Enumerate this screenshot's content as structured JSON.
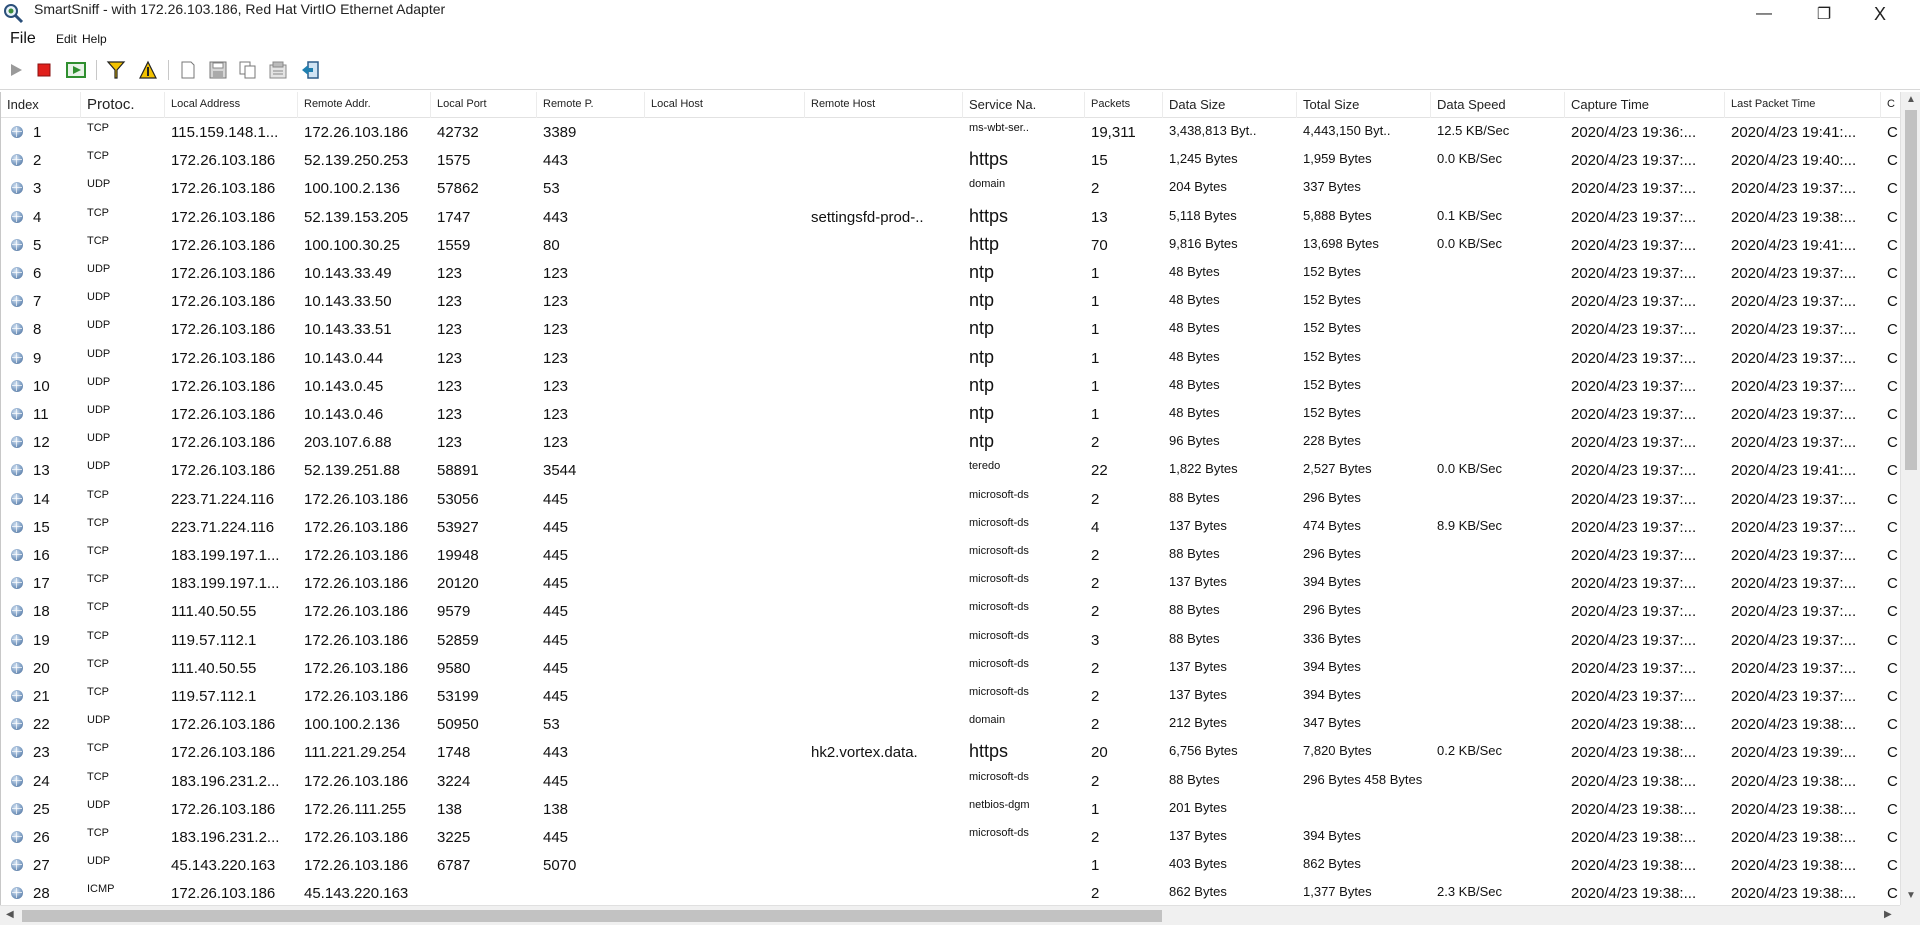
{
  "window": {
    "title": "SmartSniff - with 172.26.103.186, Red Hat VirtIO Ethernet Adapter",
    "min_glyph": "—",
    "max_glyph": "❐",
    "close_glyph": "X"
  },
  "menu": {
    "file": "File",
    "edit": "Edit",
    "help": "Help"
  },
  "toolbar": {
    "icons": [
      "play-icon",
      "stop-icon",
      "capture-icon",
      "filter-icon",
      "warning-filter-icon",
      "new-document-icon",
      "save-icon",
      "copy-icon",
      "properties-icon",
      "exit-icon"
    ],
    "colors": {
      "stop": "#e0201c",
      "play": "#9a9a9a",
      "filter": "#f2c200",
      "capture": "#2f8f2f"
    }
  },
  "columns": [
    {
      "label": "Index",
      "size": "md"
    },
    {
      "label": "Protoc.",
      "size": "xl"
    },
    {
      "label": "Local Address",
      "size": "sm"
    },
    {
      "label": "Remote Addr.",
      "size": "sm"
    },
    {
      "label": "Local Port",
      "size": "sm"
    },
    {
      "label": "Remote P.",
      "size": "sm"
    },
    {
      "label": "Local Host",
      "size": "sm"
    },
    {
      "label": "Remote Host",
      "size": "sm"
    },
    {
      "label": "Service Na.",
      "size": "md"
    },
    {
      "label": "Packets",
      "size": "sm"
    },
    {
      "label": "Data Size",
      "size": "md"
    },
    {
      "label": "Total Size",
      "size": "md"
    },
    {
      "label": "Data Speed",
      "size": "md"
    },
    {
      "label": "Capture Time",
      "size": "md"
    },
    {
      "label": "Last Packet Time",
      "size": "sm"
    },
    {
      "label": "C",
      "size": "sm"
    }
  ],
  "rows": [
    {
      "index": "1",
      "proto": "TCP",
      "laddr": "115.159.148.1...",
      "raddr": "172.26.103.186",
      "lport": "42732",
      "rport": "3389",
      "lhost": "",
      "rhost": "",
      "service": "ms-wbt-ser..",
      "packets": "19,311",
      "data": "3,438,813 Byt..",
      "total": "4,443,150 Byt..",
      "speed": "12.5 KB/Sec",
      "capture": "2020/4/23 19:36:...",
      "last": "2020/4/23 19:41:...",
      "extra": "C"
    },
    {
      "index": "2",
      "proto": "TCP",
      "laddr": "172.26.103.186",
      "raddr": "52.139.250.253",
      "lport": "1575",
      "rport": "443",
      "lhost": "",
      "rhost": "",
      "service": "https",
      "packets": "15",
      "data": "1,245 Bytes",
      "total": "1,959 Bytes",
      "speed": "0.0 KB/Sec",
      "capture": "2020/4/23 19:37:...",
      "last": "2020/4/23 19:40:...",
      "extra": "C"
    },
    {
      "index": "3",
      "proto": "UDP",
      "laddr": "172.26.103.186",
      "raddr": "100.100.2.136",
      "lport": "57862",
      "rport": "53",
      "lhost": "",
      "rhost": "",
      "service": "domain",
      "packets": "2",
      "data": "204 Bytes",
      "total": "337 Bytes",
      "speed": "",
      "capture": "2020/4/23 19:37:...",
      "last": "2020/4/23 19:37:...",
      "extra": "C"
    },
    {
      "index": "4",
      "proto": "TCP",
      "laddr": "172.26.103.186",
      "raddr": "52.139.153.205",
      "lport": "1747",
      "rport": "443",
      "lhost": "",
      "rhost": "settingsfd-prod-..",
      "service": "https",
      "packets": "13",
      "data": "5,118 Bytes",
      "total": "5,888 Bytes",
      "speed": "0.1 KB/Sec",
      "capture": "2020/4/23 19:37:...",
      "last": "2020/4/23 19:38:...",
      "extra": "C"
    },
    {
      "index": "5",
      "proto": "TCP",
      "laddr": "172.26.103.186",
      "raddr": "100.100.30.25",
      "lport": "1559",
      "rport": "80",
      "lhost": "",
      "rhost": "",
      "service": "http",
      "packets": "70",
      "data": "9,816 Bytes",
      "total": "13,698 Bytes",
      "speed": "0.0 KB/Sec",
      "capture": "2020/4/23 19:37:...",
      "last": "2020/4/23 19:41:...",
      "extra": "C"
    },
    {
      "index": "6",
      "proto": "UDP",
      "laddr": "172.26.103.186",
      "raddr": "10.143.33.49",
      "lport": "123",
      "rport": "123",
      "lhost": "",
      "rhost": "",
      "service": "ntp",
      "packets": "1",
      "data": "48 Bytes",
      "total": "152 Bytes",
      "speed": "",
      "capture": "2020/4/23 19:37:...",
      "last": "2020/4/23 19:37:...",
      "extra": "C"
    },
    {
      "index": "7",
      "proto": "UDP",
      "laddr": "172.26.103.186",
      "raddr": "10.143.33.50",
      "lport": "123",
      "rport": "123",
      "lhost": "",
      "rhost": "",
      "service": "ntp",
      "packets": "1",
      "data": "48 Bytes",
      "total": "152 Bytes",
      "speed": "",
      "capture": "2020/4/23 19:37:...",
      "last": "2020/4/23 19:37:...",
      "extra": "C"
    },
    {
      "index": "8",
      "proto": "UDP",
      "laddr": "172.26.103.186",
      "raddr": "10.143.33.51",
      "lport": "123",
      "rport": "123",
      "lhost": "",
      "rhost": "",
      "service": "ntp",
      "packets": "1",
      "data": "48 Bytes",
      "total": "152 Bytes",
      "speed": "",
      "capture": "2020/4/23 19:37:...",
      "last": "2020/4/23 19:37:...",
      "extra": "C"
    },
    {
      "index": "9",
      "proto": "UDP",
      "laddr": "172.26.103.186",
      "raddr": "10.143.0.44",
      "lport": "123",
      "rport": "123",
      "lhost": "",
      "rhost": "",
      "service": "ntp",
      "packets": "1",
      "data": "48 Bytes",
      "total": "152 Bytes",
      "speed": "",
      "capture": "2020/4/23 19:37:...",
      "last": "2020/4/23 19:37:...",
      "extra": "C"
    },
    {
      "index": "10",
      "proto": "UDP",
      "laddr": "172.26.103.186",
      "raddr": "10.143.0.45",
      "lport": "123",
      "rport": "123",
      "lhost": "",
      "rhost": "",
      "service": "ntp",
      "packets": "1",
      "data": "48 Bytes",
      "total": "152 Bytes",
      "speed": "",
      "capture": "2020/4/23 19:37:...",
      "last": "2020/4/23 19:37:...",
      "extra": "C"
    },
    {
      "index": "11",
      "proto": "UDP",
      "laddr": "172.26.103.186",
      "raddr": "10.143.0.46",
      "lport": "123",
      "rport": "123",
      "lhost": "",
      "rhost": "",
      "service": "ntp",
      "packets": "1",
      "data": "48 Bytes",
      "total": "152 Bytes",
      "speed": "",
      "capture": "2020/4/23 19:37:...",
      "last": "2020/4/23 19:37:...",
      "extra": "C"
    },
    {
      "index": "12",
      "proto": "UDP",
      "laddr": "172.26.103.186",
      "raddr": "203.107.6.88",
      "lport": "123",
      "rport": "123",
      "lhost": "",
      "rhost": "",
      "service": "ntp",
      "packets": "2",
      "data": "96 Bytes",
      "total": "228 Bytes",
      "speed": "",
      "capture": "2020/4/23 19:37:...",
      "last": "2020/4/23 19:37:...",
      "extra": "C"
    },
    {
      "index": "13",
      "proto": "UDP",
      "laddr": "172.26.103.186",
      "raddr": "52.139.251.88",
      "lport": "58891",
      "rport": "3544",
      "lhost": "",
      "rhost": "",
      "service": "teredo",
      "packets": "22",
      "data": "1,822 Bytes",
      "total": "2,527 Bytes",
      "speed": "0.0 KB/Sec",
      "capture": "2020/4/23 19:37:...",
      "last": "2020/4/23 19:41:...",
      "extra": "C"
    },
    {
      "index": "14",
      "proto": "TCP",
      "laddr": "223.71.224.116",
      "raddr": "172.26.103.186",
      "lport": "53056",
      "rport": "445",
      "lhost": "",
      "rhost": "",
      "service": "microsoft-ds",
      "packets": "2",
      "data": "88 Bytes",
      "total": "296 Bytes",
      "speed": "",
      "capture": "2020/4/23 19:37:...",
      "last": "2020/4/23 19:37:...",
      "extra": "C"
    },
    {
      "index": "15",
      "proto": "TCP",
      "laddr": "223.71.224.116",
      "raddr": "172.26.103.186",
      "lport": "53927",
      "rport": "445",
      "lhost": "",
      "rhost": "",
      "service": "microsoft-ds",
      "packets": "4",
      "data": "137 Bytes",
      "total": "474 Bytes",
      "speed": "8.9 KB/Sec",
      "capture": "2020/4/23 19:37:...",
      "last": "2020/4/23 19:37:...",
      "extra": "C"
    },
    {
      "index": "16",
      "proto": "TCP",
      "laddr": "183.199.197.1...",
      "raddr": "172.26.103.186",
      "lport": "19948",
      "rport": "445",
      "lhost": "",
      "rhost": "",
      "service": "microsoft-ds",
      "packets": "2",
      "data": "88 Bytes",
      "total": "296 Bytes",
      "speed": "",
      "capture": "2020/4/23 19:37:...",
      "last": "2020/4/23 19:37:...",
      "extra": "C"
    },
    {
      "index": "17",
      "proto": "TCP",
      "laddr": "183.199.197.1...",
      "raddr": "172.26.103.186",
      "lport": "20120",
      "rport": "445",
      "lhost": "",
      "rhost": "",
      "service": "microsoft-ds",
      "packets": "2",
      "data": "137 Bytes",
      "total": "394 Bytes",
      "speed": "",
      "capture": "2020/4/23 19:37:...",
      "last": "2020/4/23 19:37:...",
      "extra": "C"
    },
    {
      "index": "18",
      "proto": "TCP",
      "laddr": "111.40.50.55",
      "raddr": "172.26.103.186",
      "lport": "9579",
      "rport": "445",
      "lhost": "",
      "rhost": "",
      "service": "microsoft-ds",
      "packets": "2",
      "data": "88 Bytes",
      "total": "296 Bytes",
      "speed": "",
      "capture": "2020/4/23 19:37:...",
      "last": "2020/4/23 19:37:...",
      "extra": "C"
    },
    {
      "index": "19",
      "proto": "TCP",
      "laddr": "119.57.112.1",
      "raddr": "172.26.103.186",
      "lport": "52859",
      "rport": "445",
      "lhost": "",
      "rhost": "",
      "service": "microsoft-ds",
      "packets": "3",
      "data": "88 Bytes",
      "total": "336 Bytes",
      "speed": "",
      "capture": "2020/4/23 19:37:...",
      "last": "2020/4/23 19:37:...",
      "extra": "C"
    },
    {
      "index": "20",
      "proto": "TCP",
      "laddr": "111.40.50.55",
      "raddr": "172.26.103.186",
      "lport": "9580",
      "rport": "445",
      "lhost": "",
      "rhost": "",
      "service": "microsoft-ds",
      "packets": "2",
      "data": "137 Bytes",
      "total": "394 Bytes",
      "speed": "",
      "capture": "2020/4/23 19:37:...",
      "last": "2020/4/23 19:37:...",
      "extra": "C"
    },
    {
      "index": "21",
      "proto": "TCP",
      "laddr": "119.57.112.1",
      "raddr": "172.26.103.186",
      "lport": "53199",
      "rport": "445",
      "lhost": "",
      "rhost": "",
      "service": "microsoft-ds",
      "packets": "2",
      "data": "137 Bytes",
      "total": "394 Bytes",
      "speed": "",
      "capture": "2020/4/23 19:37:...",
      "last": "2020/4/23 19:37:...",
      "extra": "C"
    },
    {
      "index": "22",
      "proto": "UDP",
      "laddr": "172.26.103.186",
      "raddr": "100.100.2.136",
      "lport": "50950",
      "rport": "53",
      "lhost": "",
      "rhost": "",
      "service": "domain",
      "packets": "2",
      "data": "212 Bytes",
      "total": "347 Bytes",
      "speed": "",
      "capture": "2020/4/23 19:38:...",
      "last": "2020/4/23 19:38:...",
      "extra": "C"
    },
    {
      "index": "23",
      "proto": "TCP",
      "laddr": "172.26.103.186",
      "raddr": "111.221.29.254",
      "lport": "1748",
      "rport": "443",
      "lhost": "",
      "rhost": "hk2.vortex.data.",
      "service": "https",
      "packets": "20",
      "data": "6,756 Bytes",
      "total": "7,820 Bytes",
      "speed": "0.2 KB/Sec",
      "capture": "2020/4/23 19:38:...",
      "last": "2020/4/23 19:39:...",
      "extra": "C"
    },
    {
      "index": "24",
      "proto": "TCP",
      "laddr": "183.196.231.2...",
      "raddr": "172.26.103.186",
      "lport": "3224",
      "rport": "445",
      "lhost": "",
      "rhost": "",
      "service": "microsoft-ds",
      "packets": "2",
      "data": "88 Bytes",
      "total": "296 Bytes 458 Bytes",
      "speed": "",
      "capture": "2020/4/23 19:38:...",
      "last": "2020/4/23 19:38:...",
      "extra": "C"
    },
    {
      "index": "25",
      "proto": "UDP",
      "laddr": "172.26.103.186",
      "raddr": "172.26.111.255",
      "lport": "138",
      "rport": "138",
      "lhost": "",
      "rhost": "",
      "service": "netbios-dgm",
      "packets": "1",
      "data": "201 Bytes",
      "total": "",
      "speed": "",
      "capture": "2020/4/23 19:38:...",
      "last": "2020/4/23 19:38:...",
      "extra": "C"
    },
    {
      "index": "26",
      "proto": "TCP",
      "laddr": "183.196.231.2...",
      "raddr": "172.26.103.186",
      "lport": "3225",
      "rport": "445",
      "lhost": "",
      "rhost": "",
      "service": "microsoft-ds",
      "packets": "2",
      "data": "137 Bytes",
      "total": "394 Bytes",
      "speed": "",
      "capture": "2020/4/23 19:38:...",
      "last": "2020/4/23 19:38:...",
      "extra": "C"
    },
    {
      "index": "27",
      "proto": "UDP",
      "laddr": "45.143.220.163",
      "raddr": "172.26.103.186",
      "lport": "6787",
      "rport": "5070",
      "lhost": "",
      "rhost": "",
      "service": "",
      "packets": "1",
      "data": "403 Bytes",
      "total": "862 Bytes",
      "speed": "",
      "capture": "2020/4/23 19:38:...",
      "last": "2020/4/23 19:38:...",
      "extra": "C"
    },
    {
      "index": "28",
      "proto": "ICMP",
      "laddr": "172.26.103.186",
      "raddr": "45.143.220.163",
      "lport": "",
      "rport": "",
      "lhost": "",
      "rhost": "",
      "service": "",
      "packets": "2",
      "data": "862 Bytes",
      "total": "1,377 Bytes",
      "speed": "2.3 KB/Sec",
      "capture": "2020/4/23 19:38:...",
      "last": "2020/4/23 19:38:...",
      "extra": "C"
    }
  ],
  "scrollbars": {
    "up_glyph": "▲",
    "down_glyph": "▼",
    "left_glyph": "◀",
    "right_glyph": "▶"
  }
}
